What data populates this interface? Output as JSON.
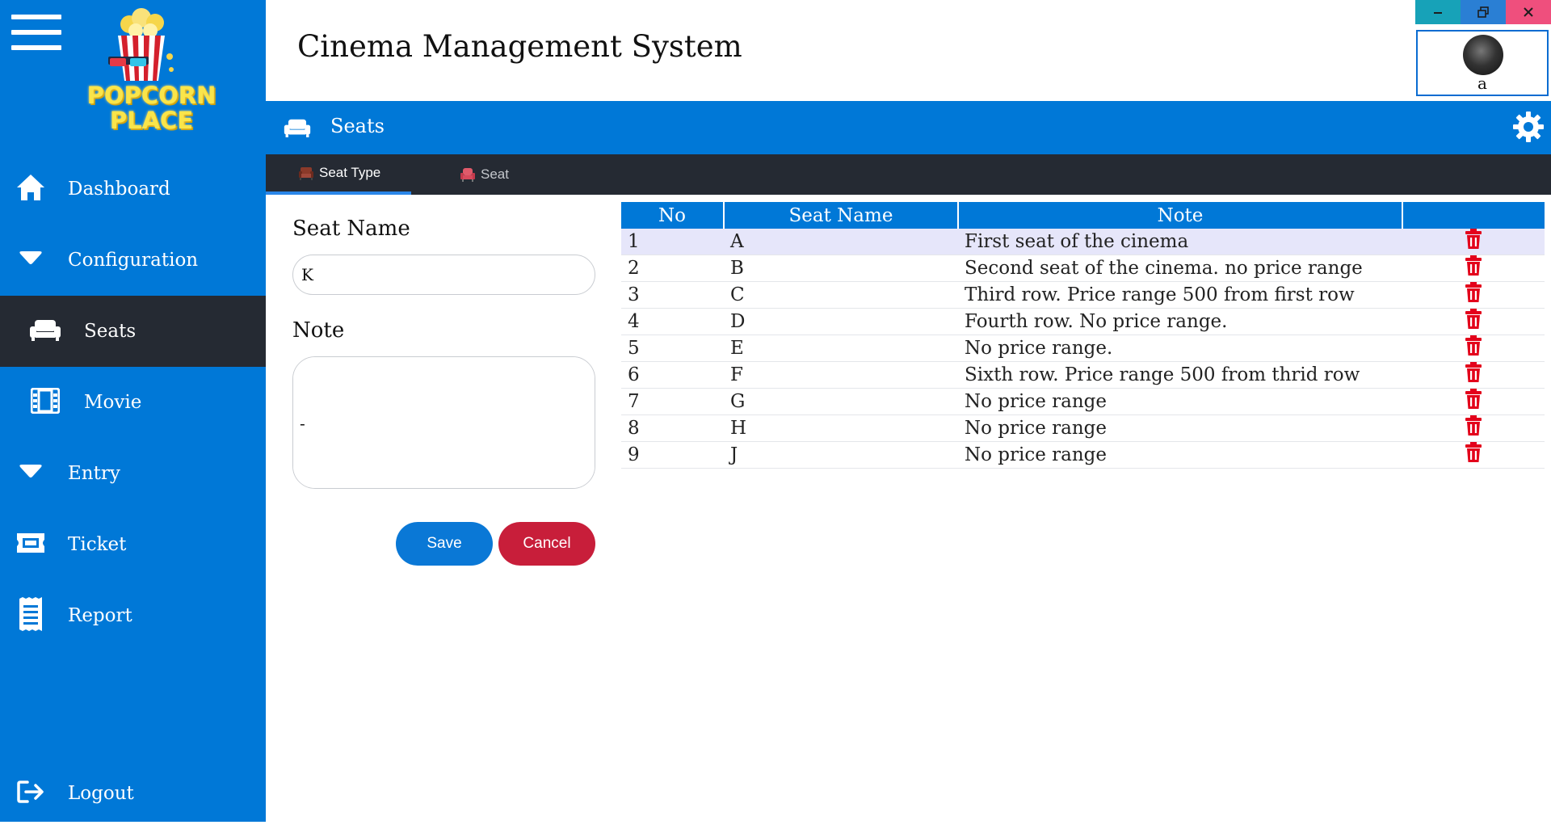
{
  "app": {
    "title": "Cinema Management System",
    "logo_line1": "POPCORN",
    "logo_line2": "PLACE"
  },
  "user": {
    "name": "a"
  },
  "sidebar": {
    "items": [
      {
        "label": "Dashboard",
        "icon": "home-icon"
      },
      {
        "label": "Configuration",
        "icon": "caret-down-icon"
      },
      {
        "label": "Seats",
        "icon": "sofa-icon",
        "active": true
      },
      {
        "label": "Movie",
        "icon": "film-icon"
      },
      {
        "label": "Entry",
        "icon": "caret-down-icon"
      },
      {
        "label": "Ticket",
        "icon": "ticket-icon"
      },
      {
        "label": "Report",
        "icon": "receipt-icon"
      },
      {
        "label": "Logout",
        "icon": "logout-icon"
      }
    ]
  },
  "section": {
    "title": "Seats"
  },
  "tabs": [
    {
      "label": "Seat Type",
      "active": true
    },
    {
      "label": "Seat",
      "active": false
    }
  ],
  "form": {
    "seat_name_label": "Seat Name",
    "seat_name_value": "K",
    "note_label": "Note",
    "note_value": "-",
    "save_label": "Save",
    "cancel_label": "Cancel"
  },
  "table": {
    "columns": [
      "No",
      "Seat Name",
      "Note",
      ""
    ],
    "rows": [
      {
        "no": "1",
        "seat": "A",
        "note": "First seat of the cinema"
      },
      {
        "no": "2",
        "seat": "B",
        "note": "Second seat of the cinema. no price range"
      },
      {
        "no": "3",
        "seat": "C",
        "note": "Third row. Price range 500 from first row"
      },
      {
        "no": "4",
        "seat": "D",
        "note": "Fourth row. No price range."
      },
      {
        "no": "5",
        "seat": "E",
        "note": "No price range."
      },
      {
        "no": "6",
        "seat": "F",
        "note": "Sixth row. Price range 500 from thrid row"
      },
      {
        "no": "7",
        "seat": "G",
        "note": "No price range"
      },
      {
        "no": "8",
        "seat": "H",
        "note": "No price range"
      },
      {
        "no": "9",
        "seat": "J",
        "note": "No price range"
      }
    ],
    "selected_row": 0
  },
  "colors": {
    "primary": "#0078d7",
    "dark": "#252a33",
    "danger": "#c81e3a",
    "trash": "#e3001b",
    "selected_row": "#e6e6fa"
  }
}
